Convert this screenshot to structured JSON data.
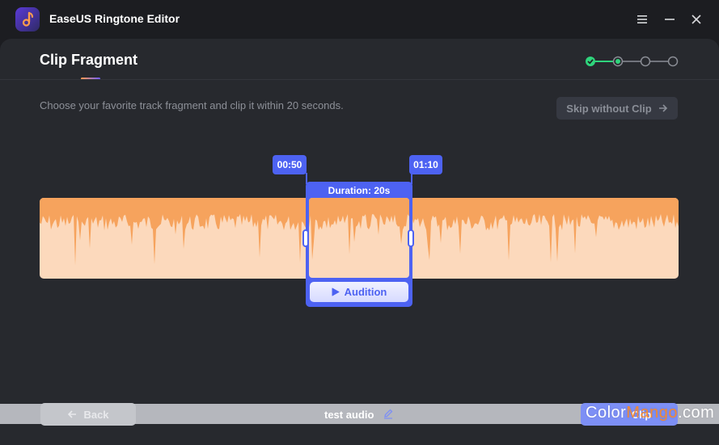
{
  "app": {
    "title": "EaseUS Ringtone Editor"
  },
  "page": {
    "title": "Clip Fragment",
    "instruction": "Choose your favorite track fragment and clip it within 20 seconds.",
    "skip_label": "Skip without Clip"
  },
  "stepper": {
    "total_steps": 4,
    "current_step": 2
  },
  "clip": {
    "start_time": "00:50",
    "end_time": "01:10",
    "duration_label": "Duration: 20s",
    "audition_label": "Audition"
  },
  "footer": {
    "back_label": "Back",
    "file_name": "test audio",
    "next_label": "Clip"
  },
  "watermark": {
    "part1": "Color",
    "part2": "Mango",
    "part3": ".com"
  },
  "colors": {
    "accent": "#4d62f2",
    "wave_fill": "#f6a35d",
    "wave_bg": "#fcd9bc",
    "step_done": "#2fd47c"
  }
}
